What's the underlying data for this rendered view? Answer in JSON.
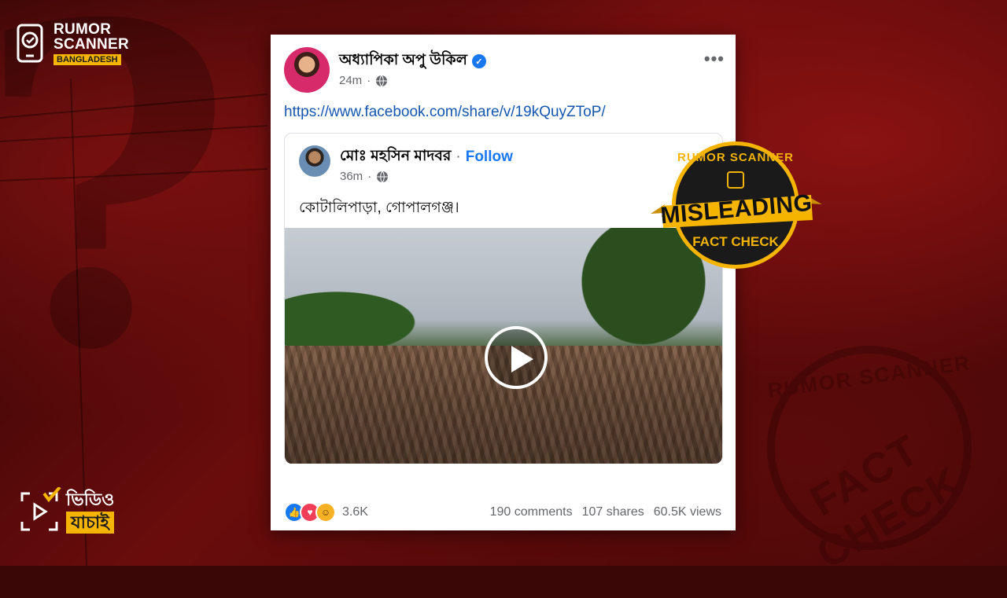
{
  "brand": {
    "line1": "RUMOR",
    "line2": "SCANNER",
    "sub": "BANGLADESH"
  },
  "video_badge": {
    "top": "ভিডিও",
    "bottom": "যাচাই"
  },
  "post": {
    "author": "অধ্যাপিকা অপু উকিল",
    "verified_icon": "verified-badge-icon",
    "time": "24m",
    "link": "https://www.facebook.com/share/v/19kQuyZToP/",
    "more_label": "•••",
    "shared": {
      "author": "মোঃ মহসিন মাদবর",
      "separator": "·",
      "follow_label": "Follow",
      "time": "36m",
      "text": "কোটালিপাড়া, গোপালগঞ্জ।"
    },
    "reactions": [
      "like",
      "love",
      "haha"
    ],
    "reaction_count": "3.6K",
    "comments": "190 comments",
    "shares": "107 shares",
    "views": "60.5K views"
  },
  "stamp": {
    "top": "RUMOR SCANNER",
    "word": "MISLEADING",
    "bottom": "FACT CHECK"
  },
  "seal": {
    "top": "RUMOR SCANNER",
    "word": "FACT CHECK"
  },
  "colors": {
    "accent": "#f5b400",
    "link": "#1557b0",
    "facebook_blue": "#1877f2",
    "background": "#5a0a0a"
  }
}
